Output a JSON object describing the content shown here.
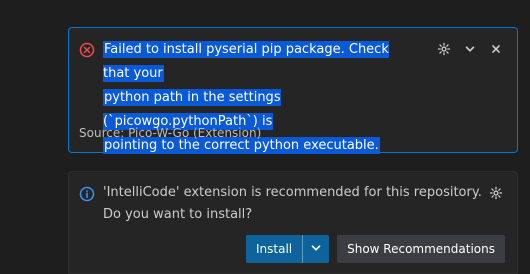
{
  "notifications": [
    {
      "kind": "error",
      "message_lines": [
        "Failed to install pyserial pip package. Check that your",
        "python path in the settings (`picowgo.pythonPath`) is",
        "pointing to the correct python executable."
      ],
      "source": "Source: Pico-W-Go (Extension)",
      "icons": {
        "status": "error-icon",
        "settings": "gear-icon",
        "expand": "chevron-down-icon",
        "close": "close-icon"
      }
    },
    {
      "kind": "info",
      "message_lines": [
        "'IntelliCode' extension is recommended for this repository.",
        "Do you want to install?"
      ],
      "buttons": {
        "install_label": "Install",
        "recommendations_label": "Show Recommendations"
      },
      "icons": {
        "status": "info-icon",
        "settings": "gear-icon",
        "dropdown": "chevron-down-icon"
      }
    }
  ],
  "colors": {
    "error": "#f14c4c",
    "info": "#3794ff",
    "selection": "#0a5ad7",
    "focus_border": "#0078d4",
    "primary_button": "#0e639c",
    "secondary_button": "#3a3d41"
  }
}
